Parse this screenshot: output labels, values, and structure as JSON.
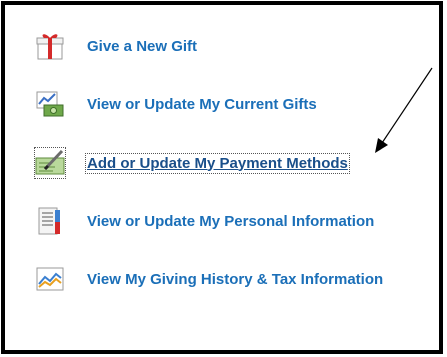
{
  "menu": {
    "items": [
      {
        "label": "Give a New Gift",
        "icon": "gift-icon"
      },
      {
        "label": "View or Update My Current Gifts",
        "icon": "money-chart-icon"
      },
      {
        "label": "Add or Update My Payment Methods",
        "icon": "check-pen-icon"
      },
      {
        "label": "View or Update My Personal Information",
        "icon": "id-document-icon"
      },
      {
        "label": "View My Giving History & Tax Information",
        "icon": "history-chart-icon"
      }
    ],
    "selected_index": 2
  },
  "colors": {
    "link": "#1b6fb8",
    "link_selected": "#1a4f8a",
    "frame_border": "#000000",
    "background": "#ffffff"
  }
}
